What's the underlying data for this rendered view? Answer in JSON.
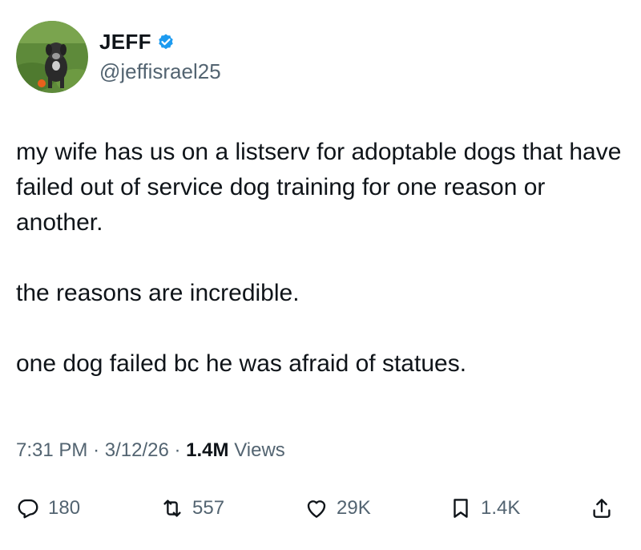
{
  "author": {
    "display_name": "JEFF",
    "handle": "@jeffisrael25",
    "verified": true,
    "verified_color": "#1d9bf0",
    "avatar_icon": "dog-on-grass-photo"
  },
  "tweet": {
    "paragraphs": [
      "my wife has us on a listserv for adoptable dogs that have failed out of service dog training for one reason or another.",
      "the reasons are incredible.",
      "one dog failed bc he was afraid of statues."
    ]
  },
  "meta": {
    "time": "7:31 PM",
    "separator": "·",
    "date": "3/12/26",
    "views_count": "1.4M",
    "views_label": "Views"
  },
  "actions": {
    "replies": {
      "icon": "reply-icon",
      "count": "180"
    },
    "retweets": {
      "icon": "retweet-icon",
      "count": "557"
    },
    "likes": {
      "icon": "heart-icon",
      "count": "29K"
    },
    "bookmarks": {
      "icon": "bookmark-icon",
      "count": "1.4K"
    },
    "share": {
      "icon": "share-icon"
    }
  },
  "colors": {
    "text": "#0f1419",
    "secondary": "#536471"
  }
}
